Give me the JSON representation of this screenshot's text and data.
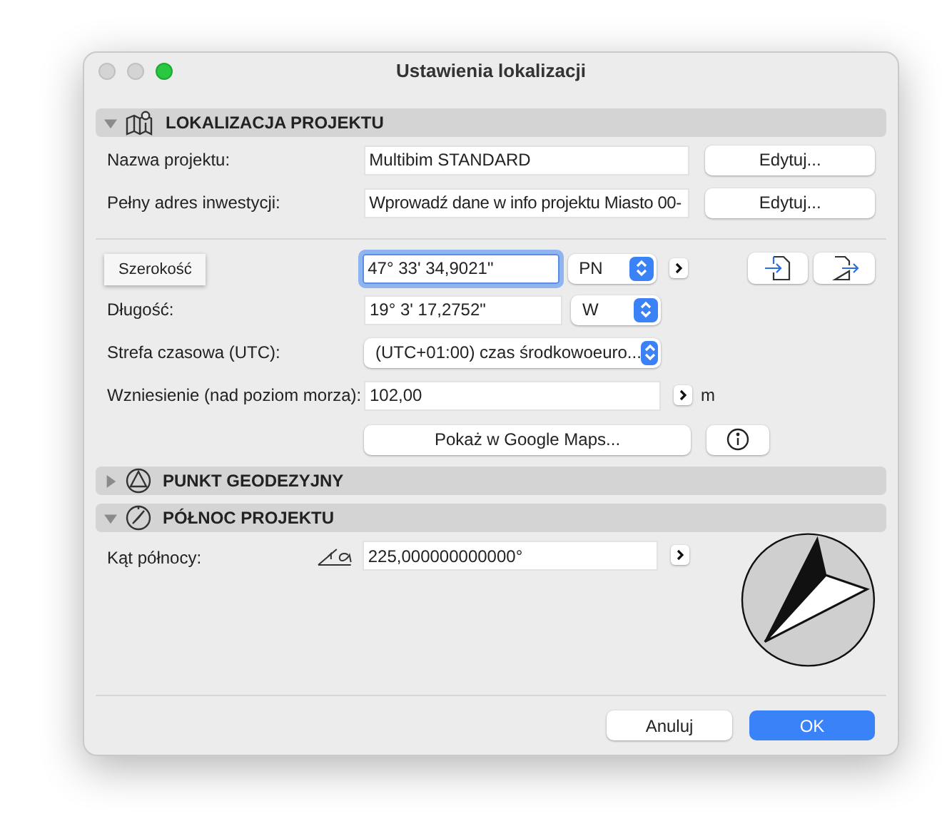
{
  "window": {
    "title": "Ustawienia lokalizacji"
  },
  "location": {
    "title": "LOKALIZACJA PROJEKTU",
    "expanded": true,
    "project_name": {
      "label": "Nazwa projektu:",
      "value": "Multibim STANDARD",
      "button": "Edytuj..."
    },
    "address": {
      "label": "Pełny adres inwestycji:",
      "value": "Wprowadź dane w info projektu Miasto 00-",
      "button": "Edytuj..."
    },
    "latitude": {
      "tooltip": "Szerokość",
      "value": "47° 33' 34,9021\"",
      "focused": true,
      "hemisphere": "PN"
    },
    "longitude": {
      "label": "Długość:",
      "value": "19° 3' 17,2752\"",
      "focused": false,
      "hemisphere": "W"
    },
    "timezone": {
      "label": "Strefa czasowa (UTC):",
      "value": "(UTC+01:00) czas środkowoeuro..."
    },
    "elevation": {
      "label": "Wzniesienie (nad poziom morza):",
      "value": "102,00",
      "unit": "m"
    },
    "maps_button": "Pokaż w Google Maps..."
  },
  "geodetic_point": {
    "title": "PUNKT GEODEZYJNY",
    "expanded": false
  },
  "project_north": {
    "title": "PÓŁNOC PROJEKTU",
    "expanded": true,
    "label": "Kąt północy:",
    "value": "225,000000000000°"
  },
  "buttons": {
    "cancel": "Anuluj",
    "ok": "OK"
  }
}
